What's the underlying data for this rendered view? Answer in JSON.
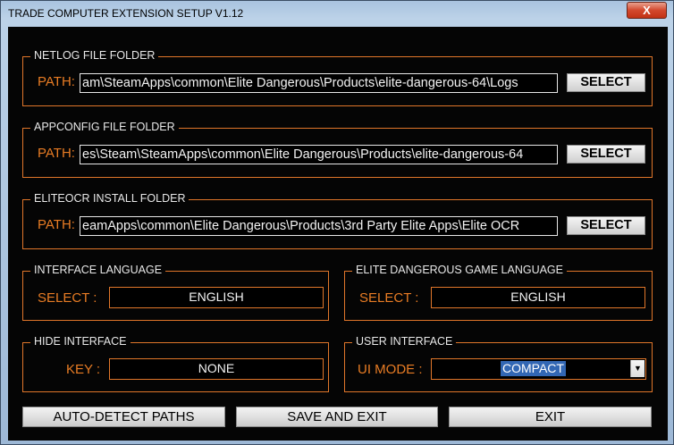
{
  "window": {
    "title": "TRADE COMPUTER EXTENSION SETUP V1.12",
    "close_icon": "close-icon",
    "close_label": "X"
  },
  "netlog": {
    "legend": "NETLOG FILE FOLDER",
    "path_label": "PATH:",
    "path_value": "am\\SteamApps\\common\\Elite Dangerous\\Products\\elite-dangerous-64\\Logs",
    "button": "SELECT"
  },
  "appconfig": {
    "legend": "APPCONFIG FILE FOLDER",
    "path_label": "PATH:",
    "path_value": "es\\Steam\\SteamApps\\common\\Elite Dangerous\\Products\\elite-dangerous-64",
    "button": "SELECT"
  },
  "eliteocr": {
    "legend": "ELITEOCR INSTALL FOLDER",
    "path_label": "PATH:",
    "path_value": "eamApps\\common\\Elite Dangerous\\Products\\3rd Party Elite Apps\\Elite OCR",
    "button": "SELECT"
  },
  "interface_language": {
    "legend": "INTERFACE LANGUAGE",
    "label": "SELECT :",
    "value": "ENGLISH"
  },
  "game_language": {
    "legend": "ELITE DANGEROUS GAME LANGUAGE",
    "label": "SELECT :",
    "value": "ENGLISH"
  },
  "hide_interface": {
    "legend": "HIDE INTERFACE",
    "label": "KEY :",
    "value": "NONE"
  },
  "user_interface": {
    "legend": "USER INTERFACE",
    "label": "UI MODE :",
    "value": "COMPACT",
    "dropdown_icon": "chevron-down-icon",
    "dropdown_glyph": "▼"
  },
  "buttons": {
    "auto_detect": "AUTO-DETECT PATHS",
    "save_exit": "SAVE AND EXIT",
    "exit": "EXIT"
  },
  "colors": {
    "accent": "#e0762a",
    "background": "#050505",
    "text": "#e8e8e8",
    "selection": "#3267b4"
  }
}
